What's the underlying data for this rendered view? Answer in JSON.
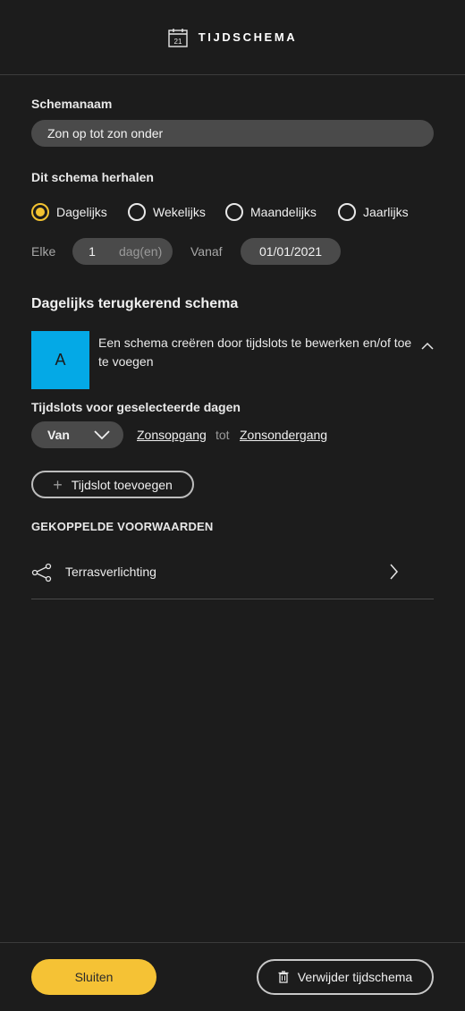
{
  "header": {
    "title": "TIJDSCHEMA",
    "icon_day": "21"
  },
  "schedule_name": {
    "label": "Schemanaam",
    "value": "Zon op tot zon onder"
  },
  "repeat": {
    "label": "Dit schema herhalen",
    "options": [
      "Dagelijks",
      "Wekelijks",
      "Maandelijks",
      "Jaarlijks"
    ],
    "selected": "Dagelijks",
    "every_label": "Elke",
    "every_value": "1",
    "every_unit": "dag(en)",
    "from_label": "Vanaf",
    "from_value": "01/01/2021"
  },
  "daily": {
    "title": "Dagelijks terugkerend schema",
    "avatar_letter": "A",
    "description": "Een schema creëren door tijdslots te bewerken en/of toe te voegen"
  },
  "timeslots": {
    "label": "Tijdslots voor geselecteerde dagen",
    "dropdown_value": "Van",
    "start": "Zonsopgang",
    "separator": "tot",
    "end": "Zonsondergang",
    "add_label": "Tijdslot toevoegen"
  },
  "conditions": {
    "title": "GEKOPPELDE VOORWAARDEN",
    "items": [
      {
        "label": "Terrasverlichting"
      }
    ]
  },
  "footer": {
    "close_label": "Sluiten",
    "delete_label": "Verwijder tijdschema"
  },
  "colors": {
    "accent": "#f5c235",
    "avatar": "#04a9e6",
    "background": "#1c1c1c",
    "field": "#4a4a4a"
  },
  "icons": [
    "calendar-icon",
    "chevron-up-icon",
    "chevron-down-icon",
    "plus-icon",
    "share-nodes-icon",
    "chevron-right-icon",
    "trash-icon"
  ]
}
